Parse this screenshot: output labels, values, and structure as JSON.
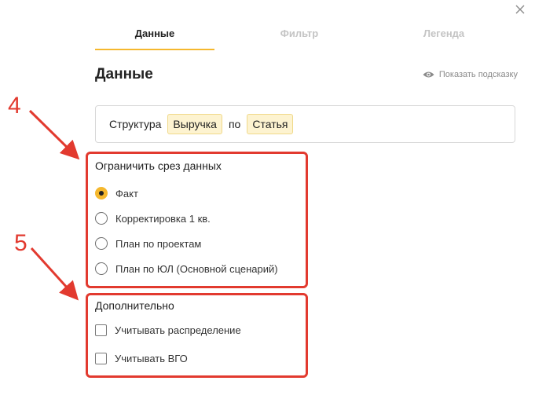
{
  "dialog": {
    "close_icon": "close-icon",
    "tabs": [
      {
        "label": "Данные",
        "active": true
      },
      {
        "label": "Фильтр",
        "active": false
      },
      {
        "label": "Легенда",
        "active": false
      }
    ],
    "title": "Данные",
    "hint": {
      "icon": "eye-icon",
      "label": "Показать подсказку"
    },
    "structure": {
      "prefix": "Структура",
      "chip1": "Выручка",
      "connector": "по",
      "chip2": "Статья"
    },
    "slice": {
      "title": "Ограничить срез данных",
      "options": [
        {
          "label": "Факт",
          "checked": true
        },
        {
          "label": "Корректировка 1 кв.",
          "checked": false
        },
        {
          "label": "План по проектам",
          "checked": false
        },
        {
          "label": "План по ЮЛ (Основной сценарий)",
          "checked": false
        }
      ]
    },
    "extra": {
      "title": "Дополнительно",
      "options": [
        {
          "label": "Учитывать распределение",
          "checked": false
        },
        {
          "label": "Учитывать ВГО",
          "checked": false
        }
      ]
    }
  },
  "annotations": {
    "label1": "4",
    "label2": "5",
    "color": "#e23a2f"
  },
  "colors": {
    "accent": "#f5b82e",
    "chip_bg": "#fdf3d0"
  }
}
